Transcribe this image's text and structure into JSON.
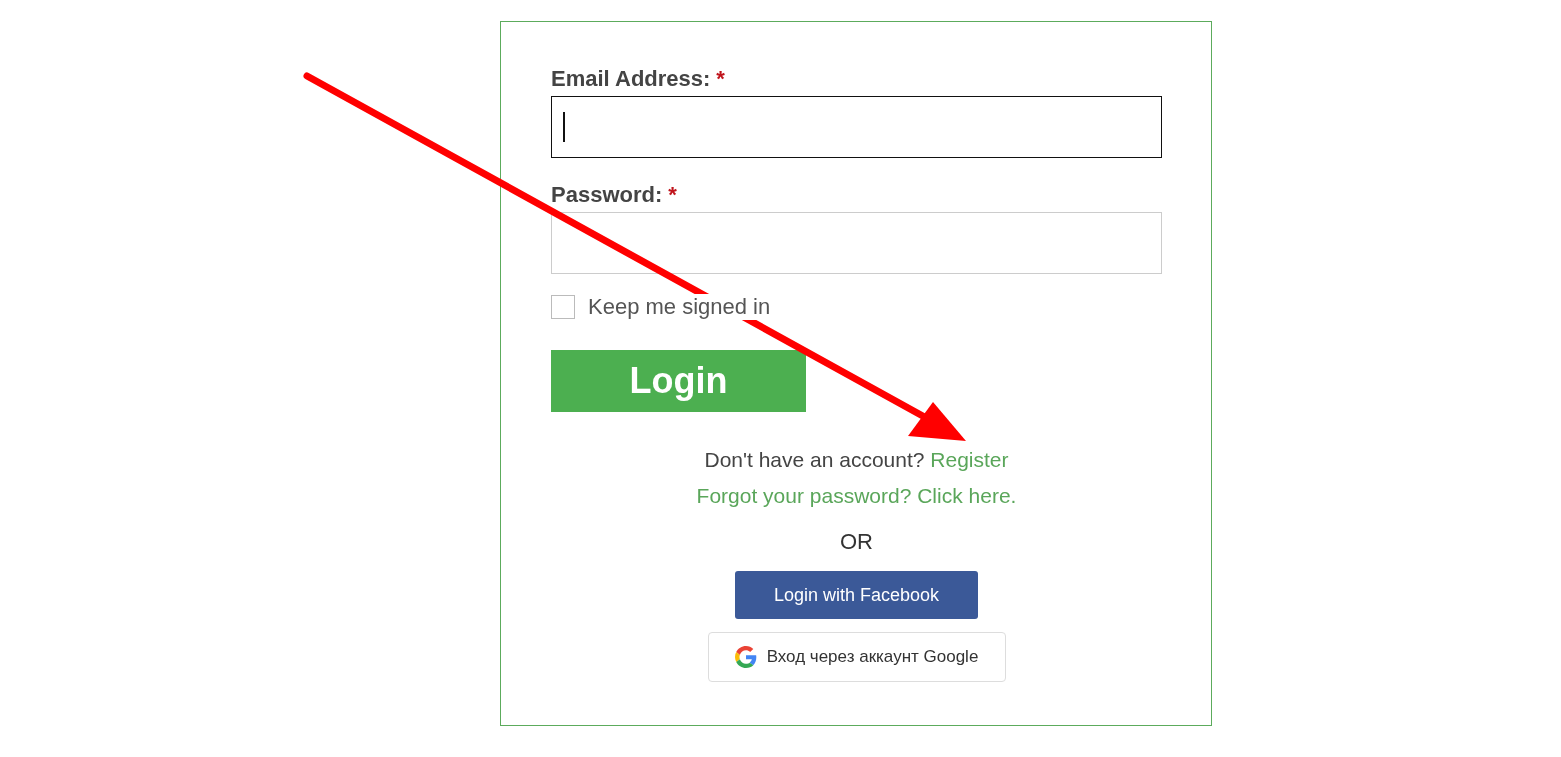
{
  "form": {
    "fields": [
      {
        "label": "Email Address:",
        "required_mark": "*",
        "focused": true
      },
      {
        "label": "Password:",
        "required_mark": "*",
        "focused": false
      }
    ],
    "remember": {
      "label": "Keep me signed in",
      "checked": false
    },
    "submit": "Login",
    "register_prompt": "Don't have an account? ",
    "register_link": "Register",
    "forgot_link": "Forgot your password? Click here.",
    "separator": "OR",
    "social_buttons": [
      {
        "kind": "facebook",
        "label": "Login with Facebook"
      },
      {
        "kind": "google",
        "label": "Вход через аккаунт Google"
      }
    ]
  }
}
